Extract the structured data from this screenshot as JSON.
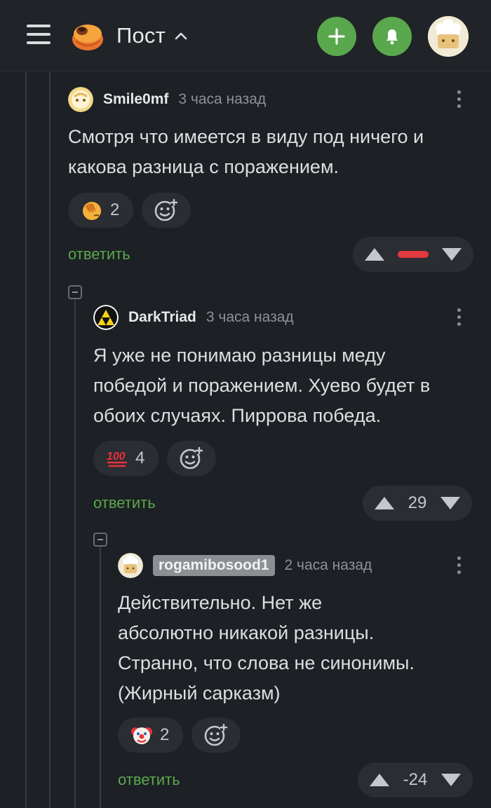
{
  "header": {
    "title": "Пост",
    "accent": "#5aa84d"
  },
  "comments": [
    {
      "user": "Smile0mf",
      "time": "3 часа назад",
      "lines": [
        "Смотря что имеется в виду под ничего и",
        "какова разница с поражением."
      ],
      "reaction": {
        "icon": "facepalm-emoji-icon",
        "count": "2"
      },
      "reply": "ответить",
      "score": "",
      "score_indicator": "negative-bar"
    },
    {
      "user": "DarkTriad",
      "time": "3 часа назад",
      "lines": [
        "Я уже не понимаю разницы меду",
        "победой и поражением. Хуево будет в",
        "обоих случаях. Пиррова победа."
      ],
      "reaction": {
        "icon": "hundred-points-emoji-icon",
        "count": "4"
      },
      "reply": "ответить",
      "score": "29"
    },
    {
      "user": "rogamibosood1",
      "time": "2 часа назад",
      "lines": [
        "Действительно. Нет же",
        "абсолютно никакой разницы.",
        "Странно, что слова не синонимы.",
        "(Жирный сарказм)"
      ],
      "reaction": {
        "icon": "clown-emoji-icon",
        "count": "2"
      },
      "reply": "ответить",
      "score": "-24"
    }
  ],
  "colors": {
    "background": "#1d2024",
    "pill": "#2a2d32",
    "negative": "#e03a3e"
  }
}
